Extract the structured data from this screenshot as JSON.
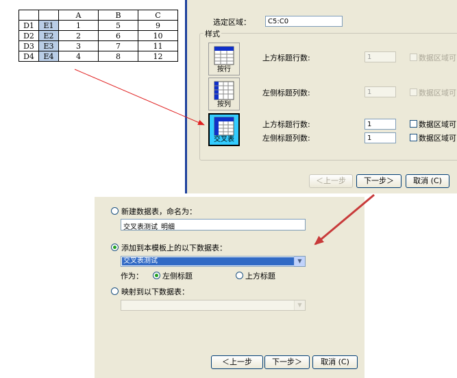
{
  "spreadsheet": {
    "columns": [
      "",
      "",
      "A",
      "B",
      "C"
    ],
    "rows": [
      [
        "D1",
        "E1",
        "1",
        "5",
        "9"
      ],
      [
        "D2",
        "E2",
        "2",
        "6",
        "10"
      ],
      [
        "D3",
        "E3",
        "3",
        "7",
        "11"
      ],
      [
        "D4",
        "E4",
        "4",
        "8",
        "12"
      ]
    ]
  },
  "dialog1": {
    "range_label": "选定区域：",
    "range_value": "C5:C0",
    "group_title": "样式",
    "styles": [
      {
        "caption": "按行",
        "icon": "row-table-icon"
      },
      {
        "caption": "按列",
        "icon": "column-table-icon"
      },
      {
        "caption": "交叉表",
        "icon": "crosstab-icon"
      }
    ],
    "row_style": {
      "header_rows_label": "上方标题行数:",
      "header_rows_value": "1",
      "checkbox_label": "数据区域可"
    },
    "col_style": {
      "header_cols_label": "左侧标题列数:",
      "header_cols_value": "1",
      "checkbox_label": "数据区域可"
    },
    "cross_style": {
      "header_rows_label": "上方标题行数:",
      "header_rows_value": "1",
      "checkbox1_label": "数据区域可",
      "header_cols_label": "左侧标题列数:",
      "header_cols_value": "1",
      "checkbox2_label": "数据区域可"
    },
    "buttons": {
      "back": "＜上一步",
      "next": "下一步＞",
      "cancel": "取消 (C)"
    }
  },
  "dialog2": {
    "new_table_label": "新建数据表，命名为：",
    "new_table_value": "交叉表测试_明细",
    "add_to_label": "添加到本模板上的以下数据表：",
    "add_to_value": "交叉表测试",
    "as_label": "作为：",
    "left_title_label": "左侧标题",
    "top_title_label": "上方标题",
    "map_label": "映射到以下数据表：",
    "buttons": {
      "back": "＜上一步",
      "next": "下一步＞",
      "cancel": "取消 (C)"
    }
  },
  "colors": {
    "arrow": "#e02020",
    "arrow2": "#c83a3a",
    "selected_style": "#33ccff",
    "highlight_cell": "#b9cde6",
    "dialog_bg": "#ece9d8",
    "selection_blue": "#316ac5"
  }
}
